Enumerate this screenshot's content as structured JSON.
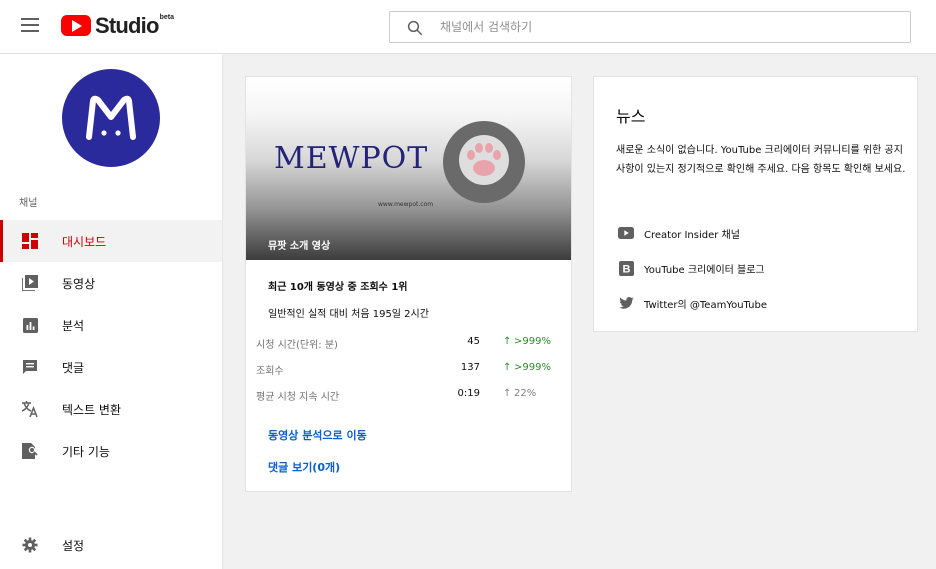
{
  "header": {
    "logo_text": "Studio",
    "logo_badge": "beta",
    "search_placeholder": "채널에서 검색하기"
  },
  "sidebar": {
    "avatar_letter": "M",
    "section_label": "채널",
    "items": [
      {
        "label": "대시보드",
        "icon": "dashboard-icon",
        "active": true
      },
      {
        "label": "동영상",
        "icon": "video-icon",
        "active": false
      },
      {
        "label": "분석",
        "icon": "analytics-icon",
        "active": false
      },
      {
        "label": "댓글",
        "icon": "comments-icon",
        "active": false
      },
      {
        "label": "텍스트 변환",
        "icon": "translate-icon",
        "active": false
      },
      {
        "label": "기타 기능",
        "icon": "other-features-icon",
        "active": false
      }
    ],
    "settings_label": "설정"
  },
  "video_card": {
    "thumbnail_brand": "MEWPOT",
    "thumbnail_url_text": "www.mewpot.com",
    "thumbnail_title": "뮤팟 소개 영상",
    "headline": "최근 10개 동영상 중 조회수 1위",
    "subline": "일반적인 실적 대비 처음 195일 2시간",
    "stats": [
      {
        "label": "시청 시간(단위: 분)",
        "value": "45",
        "change": ">999%",
        "trend": "up-strong"
      },
      {
        "label": "조회수",
        "value": "137",
        "change": ">999%",
        "trend": "up-strong"
      },
      {
        "label": "평균 시청 지속 시간",
        "value": "0:19",
        "change": "22%",
        "trend": "up-neutral"
      }
    ],
    "analytics_link": "동영상 분석으로 이동",
    "comments_link": "댓글 보기(0개)"
  },
  "news_card": {
    "title": "뉴스",
    "body": "새로운 소식이 없습니다. YouTube 크리에이터 커뮤니티를 위한 공지사항이 있는지 정기적으로 확인해 주세요. 다음 항목도 확인해 보세요.",
    "links": [
      {
        "label": "Creator Insider 채널",
        "icon": "youtube-icon"
      },
      {
        "label": "YouTube 크리에이터 블로그",
        "icon": "blogger-icon"
      },
      {
        "label": "Twitter의 @TeamYouTube",
        "icon": "twitter-icon"
      }
    ]
  },
  "colors": {
    "accent_red": "#cc0000",
    "link_blue": "#065fd4",
    "trend_green": "#2e8b2e",
    "avatar_blue": "#2a2a9c"
  }
}
